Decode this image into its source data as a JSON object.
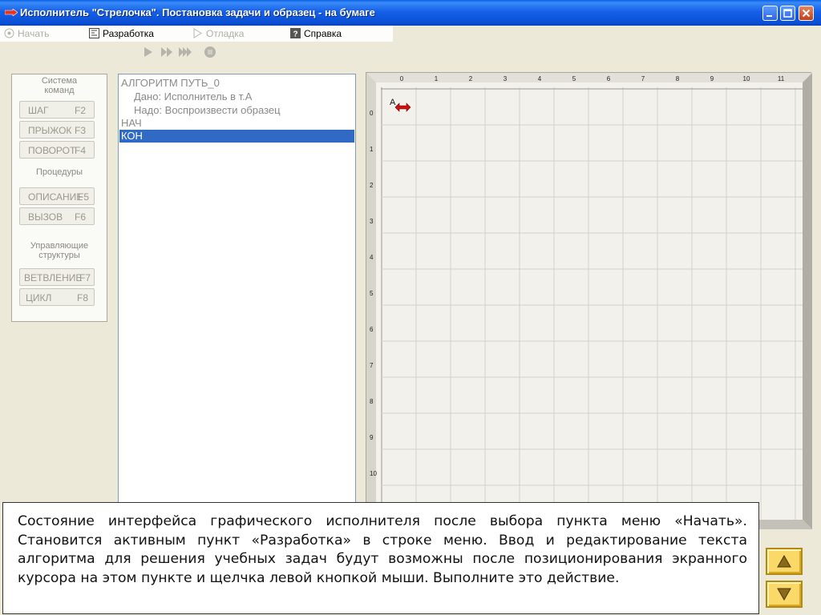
{
  "window": {
    "title": "Исполнитель \"Стрелочка\". Постановка задачи и образец - на бумаге"
  },
  "menu": {
    "items": [
      {
        "label": "Начать",
        "icon": "start-icon",
        "enabled": false
      },
      {
        "label": "Разработка",
        "icon": "develop-icon",
        "enabled": true
      },
      {
        "label": "Отладка",
        "icon": "debug-icon",
        "enabled": false
      },
      {
        "label": "Справка",
        "icon": "help-icon",
        "enabled": true
      }
    ]
  },
  "toolbar": {
    "buttons": [
      "run-icon",
      "step-forward-icon",
      "fast-forward-icon",
      "stop-icon"
    ]
  },
  "command_panel": {
    "heading_system": "Система\nкоманд",
    "heading_system_line1": "Система",
    "heading_system_line2": "команд",
    "heading_procedures": "Процедуры",
    "heading_control_line1": "Управляющие",
    "heading_control_line2": "структуры",
    "buttons": [
      {
        "label": "ШАГ",
        "key": "F2"
      },
      {
        "label": "ПРЫЖОК",
        "key": "F3"
      },
      {
        "label": "ПОВОРОТ",
        "key": "F4"
      },
      {
        "label": "ОПИСАНИЕ",
        "key": "F5"
      },
      {
        "label": "ВЫЗОВ",
        "key": "F6"
      },
      {
        "label": "ВЕТВЛЕНИЕ",
        "key": "F7"
      },
      {
        "label": "ЦИКЛ",
        "key": "F8"
      }
    ]
  },
  "editor": {
    "lines": [
      "АЛГОРИТМ ПУТЬ_0",
      "Дано: Исполнитель в т.А",
      "Надо: Воспроизвести образец",
      "НАЧ",
      "КОН"
    ],
    "selected_line_index": 4
  },
  "field": {
    "col_labels": [
      "0",
      "1",
      "2",
      "3",
      "4",
      "5",
      "6",
      "7",
      "8",
      "9",
      "10",
      "11"
    ],
    "row_labels": [
      "0",
      "1",
      "2",
      "3",
      "4",
      "5",
      "6",
      "7",
      "8",
      "9",
      "10"
    ],
    "start_point_label": "А",
    "arrow_color": "#d01010"
  },
  "caption": {
    "text": "Состояние интерфейса графического исполнителя после выбора пункта меню «Начать». Становится активным пункт «Разработка» в строке меню. Ввод и редактирование текста алгоритма для решения учебных задач будут возможны после позиционирования экранного курсора на этом пункте и щелчка левой кнопкой мыши. Выполните это действие."
  },
  "nav": {
    "up_icon": "up-arrow-icon",
    "down_icon": "down-arrow-icon"
  }
}
